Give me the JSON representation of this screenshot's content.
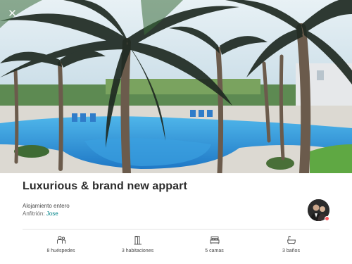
{
  "listing": {
    "title": "Luxurious & brand new appart",
    "type": "Alojamiento entero",
    "host_prefix": "Anfitrión: ",
    "host_name": "Jose"
  },
  "amenities": [
    {
      "icon": "guests-icon",
      "label": "8 huéspedes"
    },
    {
      "icon": "door-icon",
      "label": "3 habitaciones"
    },
    {
      "icon": "bed-icon",
      "label": "5 camas"
    },
    {
      "icon": "bathtub-icon",
      "label": "3 baños"
    }
  ],
  "colors": {
    "accent": "#008489",
    "badge": "#ff5a5f",
    "title": "#2b2b2b",
    "text": "#484848"
  },
  "icons": {
    "close": "close-icon"
  }
}
